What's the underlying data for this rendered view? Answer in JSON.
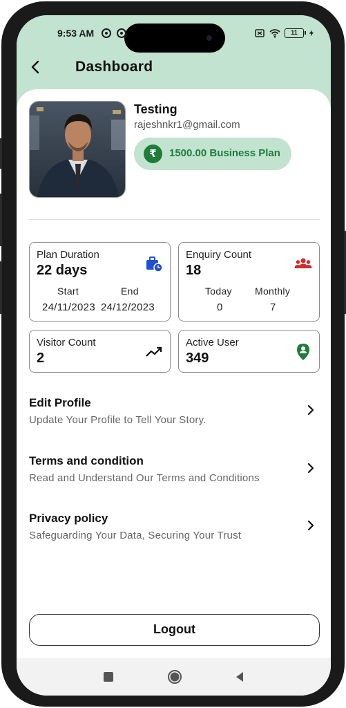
{
  "status_bar": {
    "time": "9:53 AM",
    "left_icons": [
      "sync-icon",
      "sync-icon-2"
    ],
    "right_icons": [
      "sim-off-icon",
      "wifi-icon",
      "battery-icon",
      "charging-icon"
    ],
    "battery_level": "11"
  },
  "header": {
    "back_icon": "chevron-left-icon",
    "title": "Dashboard",
    "bg_color": "#c2e3cf"
  },
  "profile": {
    "name": "Testing",
    "email": "rajeshnkr1@gmail.com",
    "plan_icon": "rupee-icon",
    "plan_symbol": "₹",
    "plan_label": "1500.00 Business Plan",
    "plan_color": "#1e7d3b"
  },
  "stats": {
    "plan_duration": {
      "label": "Plan Duration",
      "value": "22 days",
      "icon": "briefcase-clock-icon",
      "start_label": "Start",
      "end_label": "End",
      "start_value": "24/11/2023",
      "end_value": "24/12/2023"
    },
    "enquiry_count": {
      "label": "Enquiry Count",
      "value": "18",
      "icon": "group-icon",
      "today_label": "Today",
      "monthly_label": "Monthly",
      "today_value": "0",
      "monthly_value": "7"
    },
    "visitor_count": {
      "label": "Visitor Count",
      "value": "2",
      "icon": "trending-up-icon"
    },
    "active_user": {
      "label": "Active User",
      "value": "349",
      "icon": "person-pin-icon"
    }
  },
  "menu": [
    {
      "title": "Edit Profile",
      "subtitle": "Update Your Profile to Tell Your Story.",
      "icon": "chevron-right-icon"
    },
    {
      "title": "Terms and condition",
      "subtitle": "Read and Understand Our Terms and Conditions",
      "icon": "chevron-right-icon"
    },
    {
      "title": "Privacy policy",
      "subtitle": "Safeguarding Your Data, Securing Your Trust",
      "icon": "chevron-right-icon"
    }
  ],
  "logout_label": "Logout",
  "nav_bar": {
    "icons": [
      "recents-square-icon",
      "home-circle-icon",
      "back-triangle-icon"
    ]
  }
}
